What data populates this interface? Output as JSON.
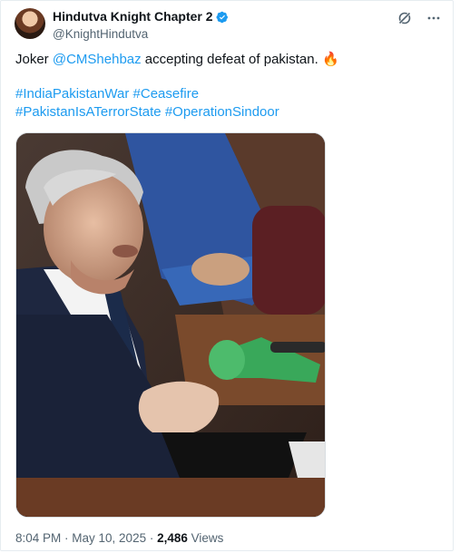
{
  "tweet": {
    "author": {
      "display_name": "Hindutva Knight Chapter 2",
      "handle": "@KnightHindutva",
      "verified": true,
      "verified_color": "#1d9bf0"
    },
    "text_before_mention": "Joker ",
    "mention": "@CMShehbaz",
    "text_after_mention": " accepting defeat of pakistan. 🔥",
    "hashtags_line1": [
      "#IndiaPakistanWar",
      "#Ceasefire"
    ],
    "hashtags_line2": [
      "#PakistanIsATerrorState",
      "#OperationSindoor"
    ],
    "time": "8:04 PM",
    "separator": " · ",
    "date": "May 10, 2025",
    "views_count": "2,486",
    "views_label": " Views",
    "link_color": "#1d9bf0",
    "icons": [
      "grok-icon",
      "more-icon",
      "verified-badge-icon"
    ]
  }
}
